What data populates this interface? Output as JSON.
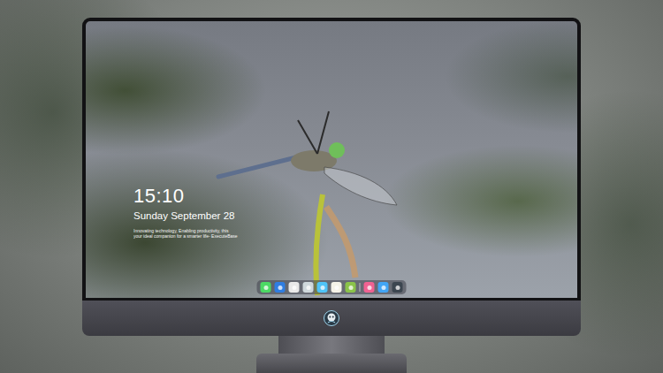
{
  "lock_screen": {
    "time": "15:10",
    "date": "Sunday September 28",
    "tagline": [
      "Innovating technology, Enabling productivity, this",
      "your ideal companion for a smarter life- ExecuteBase"
    ]
  },
  "dock": {
    "items": [
      {
        "kind": "app",
        "color": "#4cd964"
      },
      {
        "kind": "app",
        "color": "#2f7de1"
      },
      {
        "kind": "app",
        "color": "#e9e9e9"
      },
      {
        "kind": "app",
        "color": "#cfd8dc"
      },
      {
        "kind": "app",
        "color": "#4fc3f7"
      },
      {
        "kind": "app",
        "color": "#f5f3e8"
      },
      {
        "kind": "app",
        "color": "#8bc34a"
      },
      {
        "kind": "separator"
      },
      {
        "kind": "app",
        "color": "#f06292"
      },
      {
        "kind": "app",
        "color": "#42a5f5"
      },
      {
        "kind": "app",
        "color": "#3c4650"
      }
    ]
  }
}
